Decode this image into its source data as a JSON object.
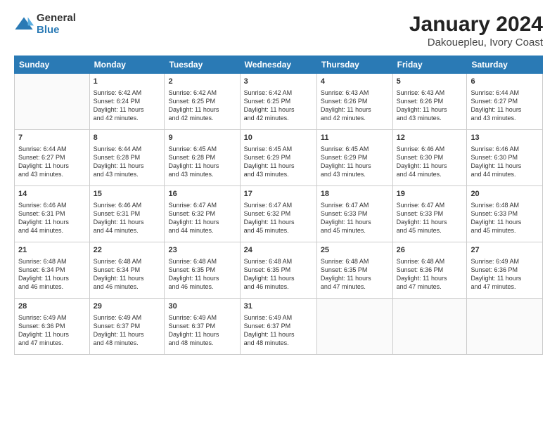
{
  "logo": {
    "general": "General",
    "blue": "Blue"
  },
  "title": "January 2024",
  "subtitle": "Dakouepleu, Ivory Coast",
  "weekdays": [
    "Sunday",
    "Monday",
    "Tuesday",
    "Wednesday",
    "Thursday",
    "Friday",
    "Saturday"
  ],
  "weeks": [
    [
      {
        "day": "",
        "info": ""
      },
      {
        "day": "1",
        "info": "Sunrise: 6:42 AM\nSunset: 6:24 PM\nDaylight: 11 hours\nand 42 minutes."
      },
      {
        "day": "2",
        "info": "Sunrise: 6:42 AM\nSunset: 6:25 PM\nDaylight: 11 hours\nand 42 minutes."
      },
      {
        "day": "3",
        "info": "Sunrise: 6:42 AM\nSunset: 6:25 PM\nDaylight: 11 hours\nand 42 minutes."
      },
      {
        "day": "4",
        "info": "Sunrise: 6:43 AM\nSunset: 6:26 PM\nDaylight: 11 hours\nand 42 minutes."
      },
      {
        "day": "5",
        "info": "Sunrise: 6:43 AM\nSunset: 6:26 PM\nDaylight: 11 hours\nand 43 minutes."
      },
      {
        "day": "6",
        "info": "Sunrise: 6:44 AM\nSunset: 6:27 PM\nDaylight: 11 hours\nand 43 minutes."
      }
    ],
    [
      {
        "day": "7",
        "info": "Sunrise: 6:44 AM\nSunset: 6:27 PM\nDaylight: 11 hours\nand 43 minutes."
      },
      {
        "day": "8",
        "info": "Sunrise: 6:44 AM\nSunset: 6:28 PM\nDaylight: 11 hours\nand 43 minutes."
      },
      {
        "day": "9",
        "info": "Sunrise: 6:45 AM\nSunset: 6:28 PM\nDaylight: 11 hours\nand 43 minutes."
      },
      {
        "day": "10",
        "info": "Sunrise: 6:45 AM\nSunset: 6:29 PM\nDaylight: 11 hours\nand 43 minutes."
      },
      {
        "day": "11",
        "info": "Sunrise: 6:45 AM\nSunset: 6:29 PM\nDaylight: 11 hours\nand 43 minutes."
      },
      {
        "day": "12",
        "info": "Sunrise: 6:46 AM\nSunset: 6:30 PM\nDaylight: 11 hours\nand 44 minutes."
      },
      {
        "day": "13",
        "info": "Sunrise: 6:46 AM\nSunset: 6:30 PM\nDaylight: 11 hours\nand 44 minutes."
      }
    ],
    [
      {
        "day": "14",
        "info": "Sunrise: 6:46 AM\nSunset: 6:31 PM\nDaylight: 11 hours\nand 44 minutes."
      },
      {
        "day": "15",
        "info": "Sunrise: 6:46 AM\nSunset: 6:31 PM\nDaylight: 11 hours\nand 44 minutes."
      },
      {
        "day": "16",
        "info": "Sunrise: 6:47 AM\nSunset: 6:32 PM\nDaylight: 11 hours\nand 44 minutes."
      },
      {
        "day": "17",
        "info": "Sunrise: 6:47 AM\nSunset: 6:32 PM\nDaylight: 11 hours\nand 45 minutes."
      },
      {
        "day": "18",
        "info": "Sunrise: 6:47 AM\nSunset: 6:33 PM\nDaylight: 11 hours\nand 45 minutes."
      },
      {
        "day": "19",
        "info": "Sunrise: 6:47 AM\nSunset: 6:33 PM\nDaylight: 11 hours\nand 45 minutes."
      },
      {
        "day": "20",
        "info": "Sunrise: 6:48 AM\nSunset: 6:33 PM\nDaylight: 11 hours\nand 45 minutes."
      }
    ],
    [
      {
        "day": "21",
        "info": "Sunrise: 6:48 AM\nSunset: 6:34 PM\nDaylight: 11 hours\nand 46 minutes."
      },
      {
        "day": "22",
        "info": "Sunrise: 6:48 AM\nSunset: 6:34 PM\nDaylight: 11 hours\nand 46 minutes."
      },
      {
        "day": "23",
        "info": "Sunrise: 6:48 AM\nSunset: 6:35 PM\nDaylight: 11 hours\nand 46 minutes."
      },
      {
        "day": "24",
        "info": "Sunrise: 6:48 AM\nSunset: 6:35 PM\nDaylight: 11 hours\nand 46 minutes."
      },
      {
        "day": "25",
        "info": "Sunrise: 6:48 AM\nSunset: 6:35 PM\nDaylight: 11 hours\nand 47 minutes."
      },
      {
        "day": "26",
        "info": "Sunrise: 6:48 AM\nSunset: 6:36 PM\nDaylight: 11 hours\nand 47 minutes."
      },
      {
        "day": "27",
        "info": "Sunrise: 6:49 AM\nSunset: 6:36 PM\nDaylight: 11 hours\nand 47 minutes."
      }
    ],
    [
      {
        "day": "28",
        "info": "Sunrise: 6:49 AM\nSunset: 6:36 PM\nDaylight: 11 hours\nand 47 minutes."
      },
      {
        "day": "29",
        "info": "Sunrise: 6:49 AM\nSunset: 6:37 PM\nDaylight: 11 hours\nand 48 minutes."
      },
      {
        "day": "30",
        "info": "Sunrise: 6:49 AM\nSunset: 6:37 PM\nDaylight: 11 hours\nand 48 minutes."
      },
      {
        "day": "31",
        "info": "Sunrise: 6:49 AM\nSunset: 6:37 PM\nDaylight: 11 hours\nand 48 minutes."
      },
      {
        "day": "",
        "info": ""
      },
      {
        "day": "",
        "info": ""
      },
      {
        "day": "",
        "info": ""
      }
    ]
  ]
}
